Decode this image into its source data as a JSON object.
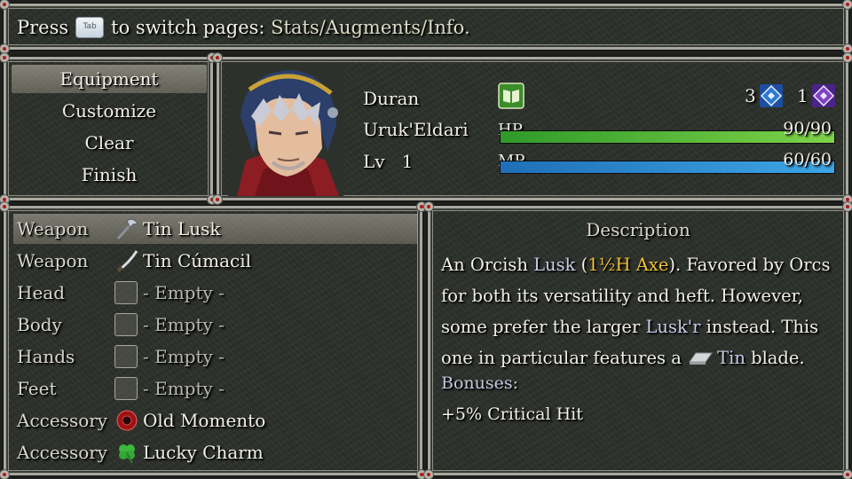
{
  "help": {
    "press": "Press",
    "key_label": "Tab",
    "to_switch": "to switch pages:",
    "pages": "Stats/Augments/Info."
  },
  "menu": {
    "items": [
      "Equipment",
      "Customize",
      "Clear",
      "Finish"
    ],
    "selected_index": 0
  },
  "actor": {
    "name": "Duran",
    "race": "Uruk'Eldari",
    "level_label": "Lv",
    "level": "1",
    "hp_label": "HP",
    "hp_text": "90/90",
    "hp_fraction": 1.0,
    "mp_label": "MP",
    "mp_text": "60/60",
    "mp_fraction": 1.0,
    "points_a": "3",
    "points_b": "1",
    "colors": {
      "hp": "#7ed348",
      "mp": "#3ea6e6",
      "gold": "#f2c233"
    }
  },
  "equipment": {
    "selected_index": 0,
    "slots": [
      {
        "slot": "Weapon",
        "item": "Tin Lusk",
        "icon": "axe-icon",
        "empty": false
      },
      {
        "slot": "Weapon",
        "item": "Tin Cúmacil",
        "icon": "sword-icon",
        "empty": false
      },
      {
        "slot": "Head",
        "item": "- Empty -",
        "icon": "empty-slot-icon",
        "empty": true
      },
      {
        "slot": "Body",
        "item": "- Empty -",
        "icon": "empty-slot-icon",
        "empty": true
      },
      {
        "slot": "Hands",
        "item": "- Empty -",
        "icon": "empty-slot-icon",
        "empty": true
      },
      {
        "slot": "Feet",
        "item": "- Empty -",
        "icon": "empty-slot-icon",
        "empty": true
      },
      {
        "slot": "Accessory",
        "item": "Old Momento",
        "icon": "red-medallion-icon",
        "empty": false
      },
      {
        "slot": "Accessory",
        "item": "Lucky Charm",
        "icon": "clover-icon",
        "empty": false
      }
    ]
  },
  "description": {
    "title": "Description",
    "p1": "An Orcish ",
    "kw_lusk": "Lusk",
    "p2": " (",
    "hand": "1½H Axe",
    "p3": "). Favored by Orcs for both its versatility and heft. However, some prefer the larger ",
    "kw_luskr": "Lusk'r",
    "p4": " instead. This one in particular features a ",
    "kw_tin": "Tin",
    "p5": " blade.",
    "bonuses_label": "Bonuses:",
    "bonus": "+5% Critical Hit"
  }
}
